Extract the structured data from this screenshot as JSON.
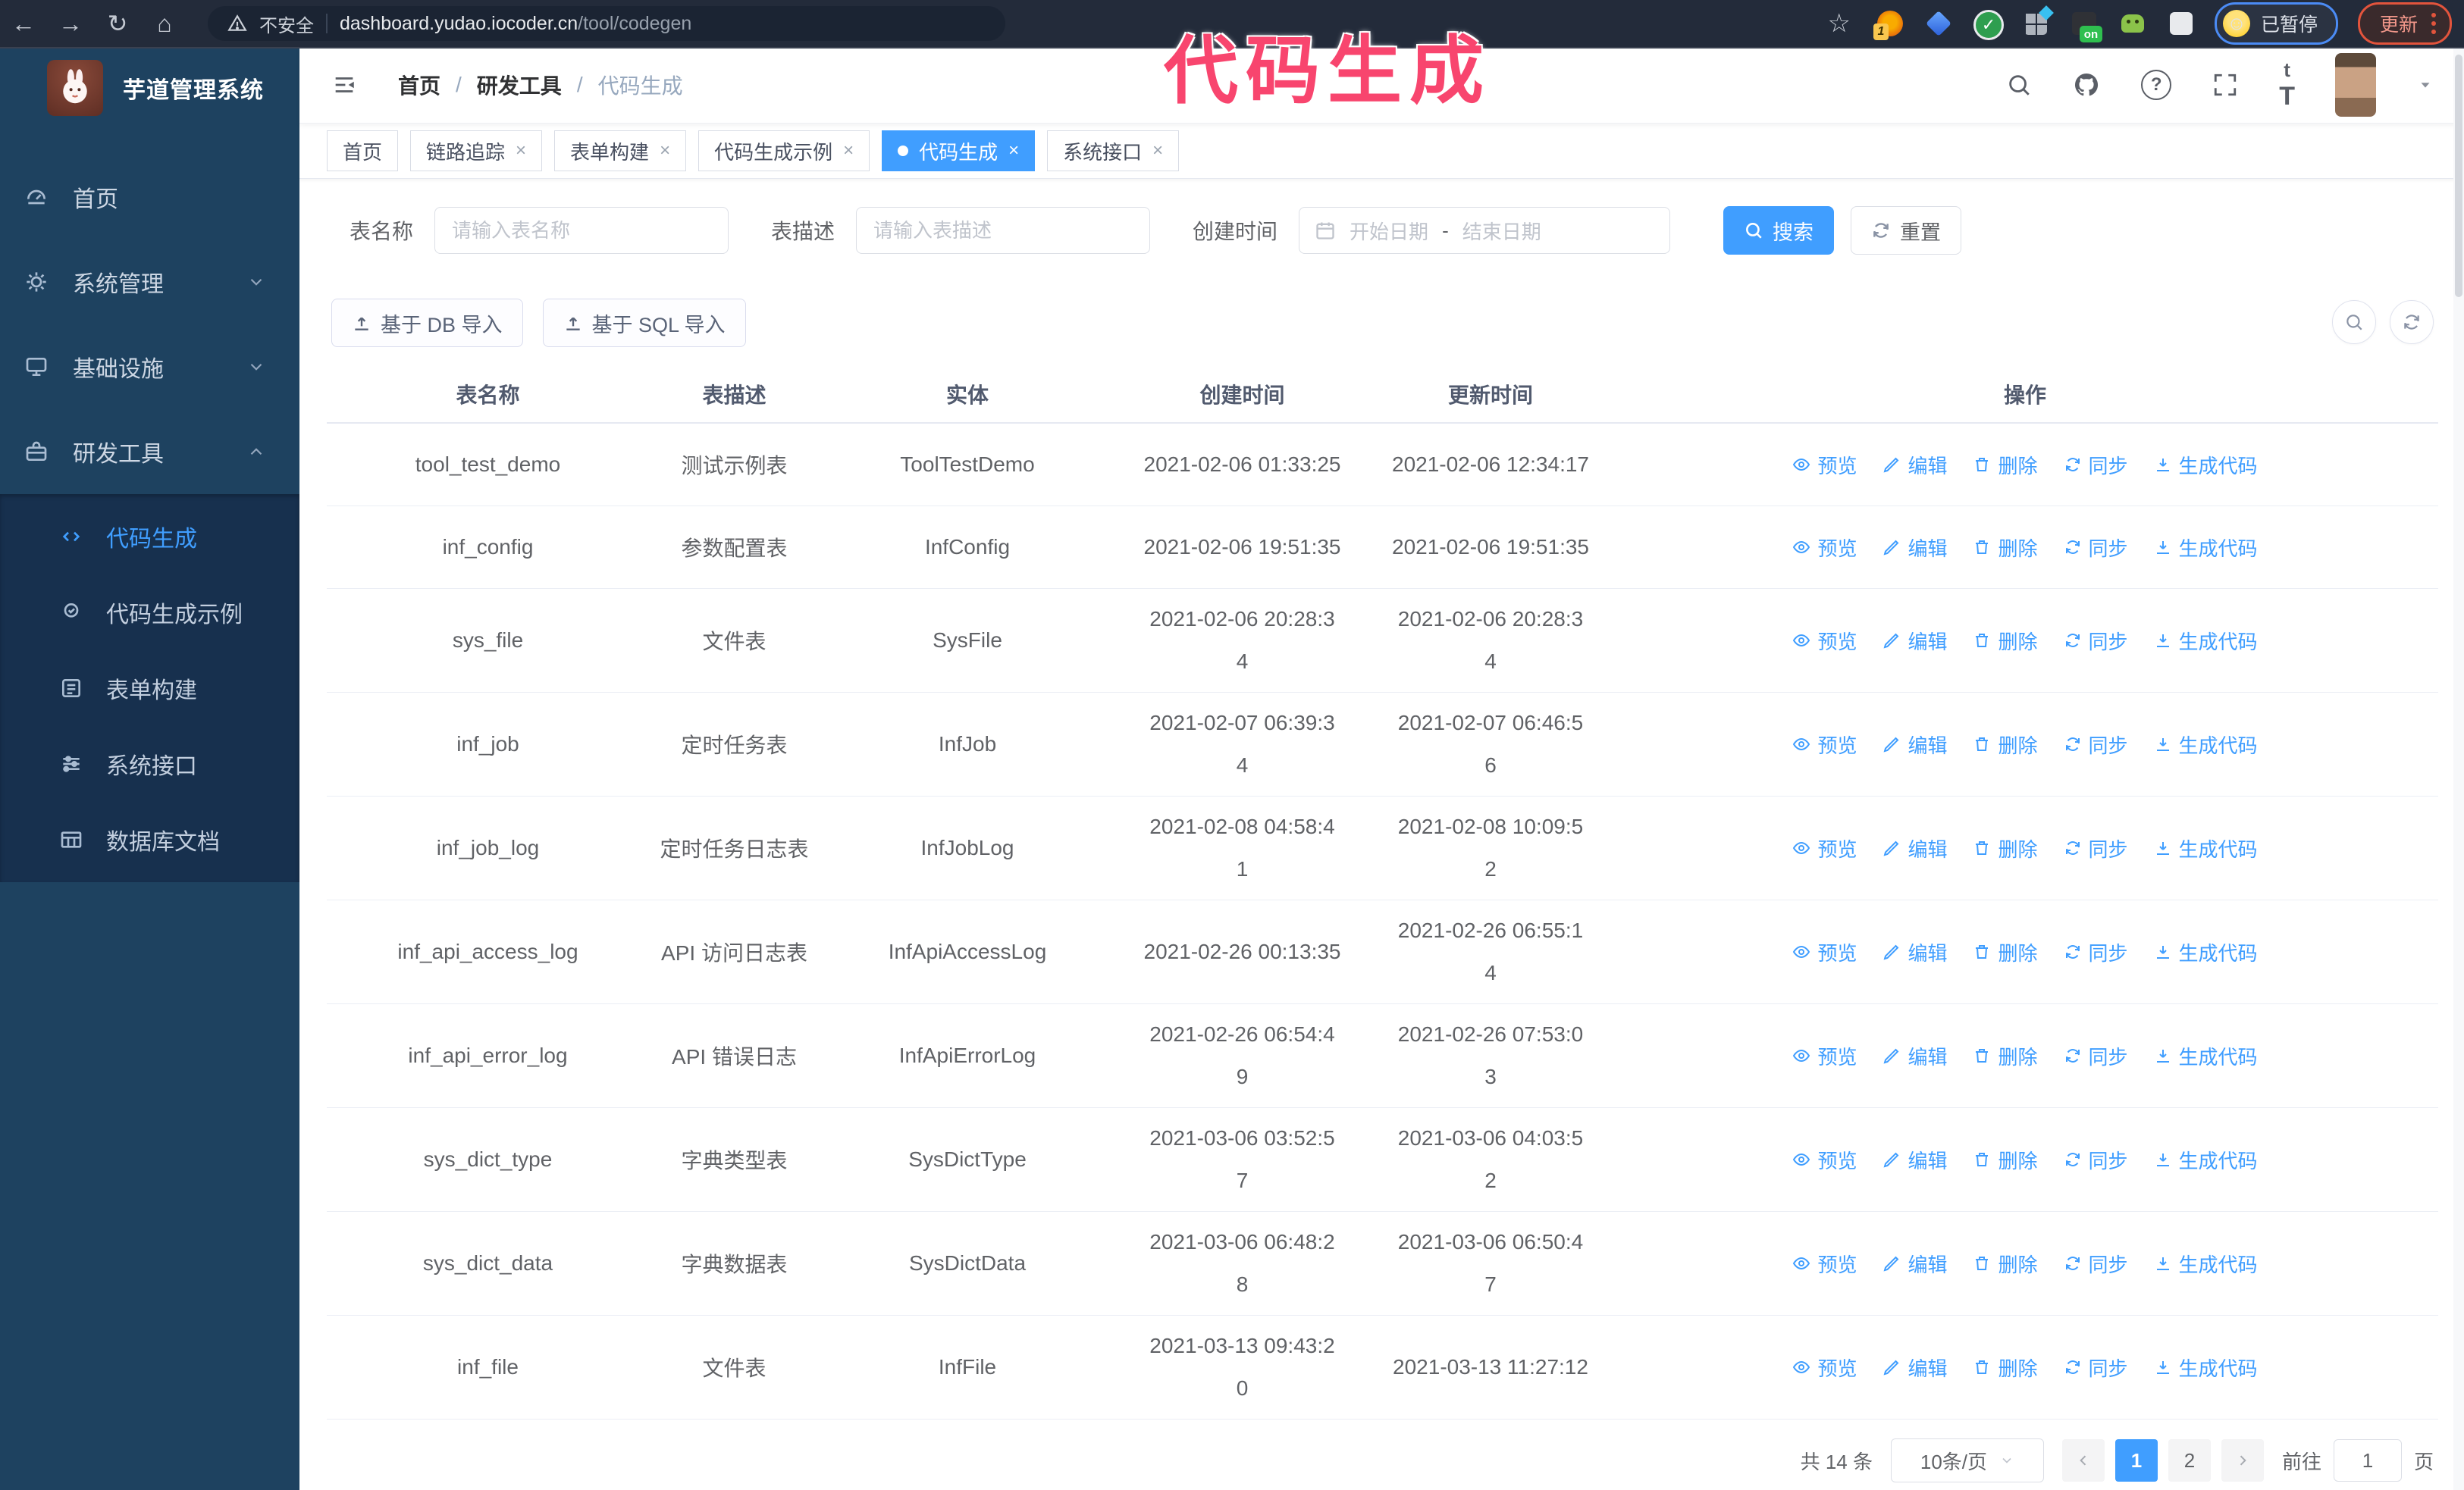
{
  "colors": {
    "accent": "#409eff",
    "pink": "#f8456e",
    "browser-bg": "#232b3a",
    "sidebar-bg": "#1e4260",
    "submenu-bg": "#17304e"
  },
  "annotation": {
    "text": "代码生成"
  },
  "browser": {
    "security_warning": "不安全",
    "url_host": "dashboard.yudao.iocoder.cn",
    "url_path": "/tool/codegen",
    "ext_badge": "1",
    "ext_on_label": "on",
    "paused_badge": "已暂停",
    "update_button": "更新"
  },
  "sidebar": {
    "title": "芋道管理系统",
    "items": [
      {
        "label": "首页"
      },
      {
        "label": "系统管理"
      },
      {
        "label": "基础设施"
      },
      {
        "label": "研发工具"
      }
    ],
    "subitems": [
      {
        "label": "代码生成",
        "active": true
      },
      {
        "label": "代码生成示例"
      },
      {
        "label": "表单构建"
      },
      {
        "label": "系统接口"
      },
      {
        "label": "数据库文档"
      }
    ]
  },
  "header": {
    "breadcrumb": [
      "首页",
      "研发工具",
      "代码生成"
    ],
    "separator": "/"
  },
  "tabs": [
    {
      "label": "首页",
      "closable": false,
      "active": false
    },
    {
      "label": "链路追踪",
      "closable": true,
      "active": false
    },
    {
      "label": "表单构建",
      "closable": true,
      "active": false
    },
    {
      "label": "代码生成示例",
      "closable": true,
      "active": false
    },
    {
      "label": "代码生成",
      "closable": true,
      "active": true
    },
    {
      "label": "系统接口",
      "closable": true,
      "active": false
    }
  ],
  "filters": {
    "table_name_label": "表名称",
    "table_name_placeholder": "请输入表名称",
    "table_desc_label": "表描述",
    "table_desc_placeholder": "请输入表描述",
    "create_time_label": "创建时间",
    "date_start_placeholder": "开始日期",
    "date_separator": "-",
    "date_end_placeholder": "结束日期",
    "search_button": "搜索",
    "reset_button": "重置"
  },
  "toolbar": {
    "import_db_button": "基于 DB 导入",
    "import_sql_button": "基于 SQL 导入"
  },
  "table": {
    "columns": [
      "表名称",
      "表描述",
      "实体",
      "创建时间",
      "更新时间",
      "操作"
    ],
    "actions": [
      "预览",
      "编辑",
      "删除",
      "同步",
      "生成代码"
    ],
    "rows": [
      {
        "name": "tool_test_demo",
        "desc": "测试示例表",
        "entity": "ToolTestDemo",
        "created": "2021-02-06 01:33:25",
        "updated": "2021-02-06 12:34:17"
      },
      {
        "name": "inf_config",
        "desc": "参数配置表",
        "entity": "InfConfig",
        "created": "2021-02-06 19:51:35",
        "updated": "2021-02-06 19:51:35"
      },
      {
        "name": "sys_file",
        "desc": "文件表",
        "entity": "SysFile",
        "created": "2021-02-06 20:28:3\n4",
        "updated": "2021-02-06 20:28:3\n4"
      },
      {
        "name": "inf_job",
        "desc": "定时任务表",
        "entity": "InfJob",
        "created": "2021-02-07 06:39:3\n4",
        "updated": "2021-02-07 06:46:5\n6"
      },
      {
        "name": "inf_job_log",
        "desc": "定时任务日志表",
        "entity": "InfJobLog",
        "created": "2021-02-08 04:58:4\n1",
        "updated": "2021-02-08 10:09:5\n2"
      },
      {
        "name": "inf_api_access_log",
        "desc": "API 访问日志表",
        "entity": "InfApiAccessLog",
        "created": "2021-02-26 00:13:35",
        "updated": "2021-02-26 06:55:1\n4"
      },
      {
        "name": "inf_api_error_log",
        "desc": "API 错误日志",
        "entity": "InfApiErrorLog",
        "created": "2021-02-26 06:54:4\n9",
        "updated": "2021-02-26 07:53:0\n3"
      },
      {
        "name": "sys_dict_type",
        "desc": "字典类型表",
        "entity": "SysDictType",
        "created": "2021-03-06 03:52:5\n7",
        "updated": "2021-03-06 04:03:5\n2"
      },
      {
        "name": "sys_dict_data",
        "desc": "字典数据表",
        "entity": "SysDictData",
        "created": "2021-03-06 06:48:2\n8",
        "updated": "2021-03-06 06:50:4\n7"
      },
      {
        "name": "inf_file",
        "desc": "文件表",
        "entity": "InfFile",
        "created": "2021-03-13 09:43:2\n0",
        "updated": "2021-03-13 11:27:12"
      }
    ]
  },
  "pagination": {
    "total": "共 14 条",
    "page_size": "10条/页",
    "pages": [
      {
        "label": "1",
        "active": true
      },
      {
        "label": "2",
        "active": false
      }
    ],
    "goto_label": "前往",
    "goto_value": "1",
    "page_label": "页"
  }
}
